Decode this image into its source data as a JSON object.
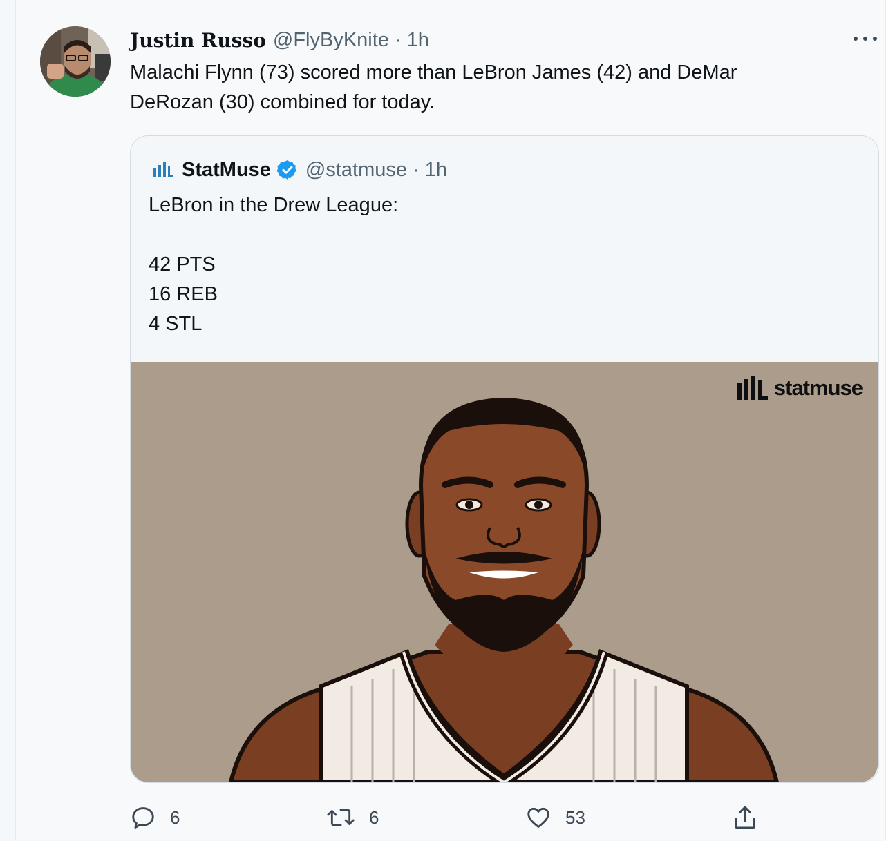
{
  "tweet": {
    "author_name": "Justin Russo",
    "author_handle": "@FlyByKnite",
    "separator": "·",
    "time": "1h",
    "text": "Malachi Flynn (73) scored more than LeBron James (42) and DeMar DeRozan (30) combined for today."
  },
  "quote": {
    "author_name": "StatMuse",
    "author_handle": "@statmuse",
    "separator": "·",
    "time": "1h",
    "lines": [
      "LeBron in the Drew League:",
      "",
      "42 PTS",
      "16 REB",
      "4 STL"
    ],
    "media": {
      "watermark": "statmuse",
      "background_color": "#ac9c8c"
    }
  },
  "actions": {
    "reply_count": "6",
    "retweet_count": "6",
    "like_count": "53"
  },
  "icons": [
    "avatar",
    "more-icon",
    "statmuse-logo-icon",
    "verified-badge-icon",
    "reply-icon",
    "retweet-icon",
    "like-icon",
    "share-icon"
  ]
}
